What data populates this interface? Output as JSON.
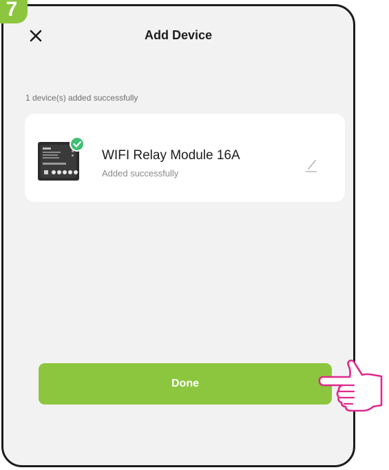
{
  "step": {
    "number": "7"
  },
  "header": {
    "title": "Add Device"
  },
  "status": {
    "message": "1 device(s) added successfully"
  },
  "device": {
    "name": "WIFI Relay Module 16A",
    "status": "Added successfully",
    "thumbnail_icon": "relay-module-thumbnail"
  },
  "actions": {
    "done_label": "Done"
  },
  "colors": {
    "accent": "#8cc63f",
    "hand_outline": "#e0288c",
    "background": "#f2f2f2",
    "card": "#ffffff"
  }
}
